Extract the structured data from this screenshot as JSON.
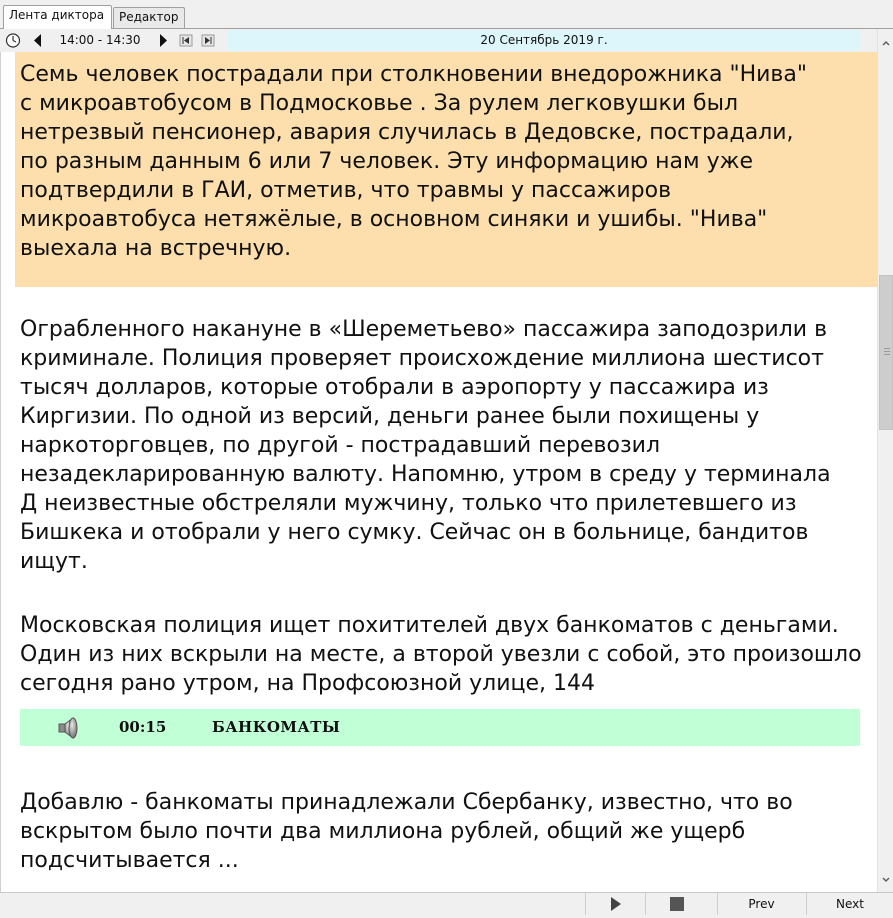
{
  "tabs": [
    {
      "label": "Лента диктора",
      "active": true
    },
    {
      "label": "Редактор",
      "active": false
    }
  ],
  "toolbar": {
    "time_range": "14:00 - 14:30",
    "date": "20 Сентябрь 2019 г."
  },
  "items": [
    {
      "text": "Семь человек пострадали при столкновении внедорожника \"Нива\" с микроавтобусом в Подмосковье . За рулем легковушки был нетрезвый пенсионер, авария случилась в Дедовске, пострадали, по разным данным 6 или 7 человек. Эту информацию нам уже подтвердили в ГАИ, отметив, что травмы у пассажиров микроавтобуса нетяжёлые, в основном синяки и ушибы. \"Нива\" выехала на встречную.",
      "highlight_color": "#fddfad"
    },
    {
      "text": "Ограбленного накануне в «Шереметьево» пассажира заподозрили в криминале. Полиция проверяет происхождение миллиона шестисот тысяч долларов, которые отобрали в аэропорту у пассажира из Киргизии. По одной из версий, деньги ранее были похищены у наркоторговцев, по другой - пострадавший перевозил незадекларированную валюту. Напомню, утром в среду у терминала Д неизвестные обстреляли мужчину, только что прилетевшего из Бишкека и отобрали у него сумку. Сейчас он в больнице, бандитов ищут."
    },
    {
      "text": "Московская полиция ищет похитителей двух банкоматов с деньгами. Один из них вскрыли на месте, а второй увезли с собой, это произошло сегодня рано утром, на Профсоюзной улице, 144"
    },
    {
      "text": "Добавлю - банкоматы принадлежали Сбербанку, известно, что во вскрытом было почти два миллиона рублей, общий же ущерб подсчитывается ..."
    }
  ],
  "audio": {
    "time": "00:15",
    "label": "БАНКОМАТЫ",
    "icon": "speaker-icon",
    "color": "#c1ffd7"
  },
  "bottom": {
    "play_icon": "play-icon",
    "stop_icon": "stop-icon",
    "prev_label": "Prev",
    "next_label": "Next"
  }
}
